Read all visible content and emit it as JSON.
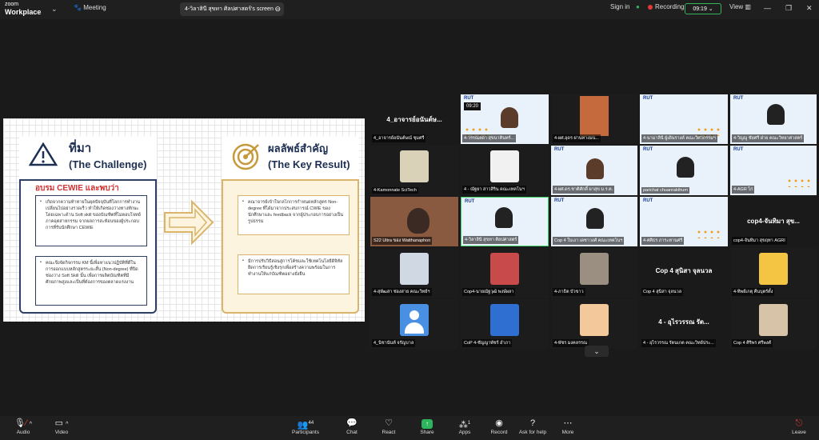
{
  "app": {
    "brand_line1": "zoom",
    "brand_line2": "Workplace"
  },
  "topbar": {
    "meeting_label": "Meeting",
    "screen_tab": "4-วิลาสินี สุขทา ศิลปศาสตร์'s screen",
    "signin": "Sign in",
    "recording": "Recording",
    "time": "09:19",
    "view": "View"
  },
  "slide": {
    "left_title_th": "ที่มา",
    "left_title_en": "(The Challenge)",
    "left_red_title": "อบรม CEWIE และพบว่า",
    "left_item1": "เกิดจากความท้าทายในยุคปัจจุบันที่โลกการทำงานเปลี่ยนไปอย่างรวดเร็ว ทำให้เกิดช่องว่างทางทักษะ โดยเฉพาะด้าน Soft skill ของบัณฑิตที่ไม่ตอบโจทย์ภาคอุตสาหกรรม จากผลการสะท้อนของผู้ประกอบการที่รับนักศึกษา CEWIE",
    "left_item2": "คณะจึงจัดกิจกรรม KM นี้เพื่อหาแนวปฏิบัติที่ดีในการออกแบบหลักสูตรระยะสั้น (Non-degree) ที่ปิดช่องว่าง Soft Skill นั้น เพื่อการผลิตบัณฑิตที่มีศักยภาพสูงและเป็นที่ต้องการของตลาดแรงงาน",
    "right_title_th": "ผลลัพธ์สำคัญ",
    "right_title_en": "(The Key Result)",
    "right_item1": "คณาจารย์เข้าใจกลไกการกำหนดหลักสูตร Non-degree ที่ได้มาจากประสบการณ์ CWIE ของนักศึกษาและ feedback จากผู้ประกอบการอย่างเป็นรูปธรรม",
    "right_item2": "มีการปรับวิธีสอนสู่การโค้ชและใช้เทคโนโลยีดิจิทัลยึดการเรียนรู้เชิงรุกเพื่อสร้างความพร้อมในการทำงานให้แก่บัณฑิตอย่างยั่งยืน"
  },
  "gallery": {
    "tiles": [
      {
        "big": "4_อาจารย์อนันต์ษ...",
        "name": "4_อาจารย์อนันต์ษณ์ ชุมศรี"
      },
      {
        "name": "4-วรรณลดา สุขนาคินทร์..."
      },
      {
        "name": "4-ผศ.อุดร ผ่านทางมน..."
      },
      {
        "name": "4-นามาลินี ผู้เดินรางค์ คณะวิศวกรรมฯ"
      },
      {
        "name": "4-วิญญู ชัยศรี ฝ่าย คณะวิทยาศาสตร์"
      },
      {
        "name": "4-Kamonnate SciTech"
      },
      {
        "name": "4 - ณัฐยา สาวสิริน คณะเทคโนฯ"
      },
      {
        "name": "4-ผศ.ดร.ชาติศักดิ์ ผาสุข ม.ร.ต."
      },
      {
        "name": "parichat chuanrakthum"
      },
      {
        "name": "4-AGR ไก่"
      },
      {
        "name": "S22 Ultra ของ Watthanaphon"
      },
      {
        "name": "4-วิลาสินี สุขทา ศิลปศาสตร์"
      },
      {
        "name": "Cop 4 ใบเงา เดชาวงศ์ คณะเทคโนฯ"
      },
      {
        "name": "4-ศศิธร ภาระทานศรี"
      },
      {
        "big": "cop4-จันทิมา สุข...",
        "name": "cop4-จันทิมา สุขฤทา AGRI"
      },
      {
        "name": "4-สุพัฒสา ช่องสาย คณะวิทย์ฯ"
      },
      {
        "name": "Cop4-นายณัฐวุฒิ พงษ์ผลา"
      },
      {
        "name": "4-ภาธิต บัวขาว"
      },
      {
        "big": "Cop 4 สุนิสา จุลนวล",
        "name": "Cop 4 สุนิสา จุลนวล"
      },
      {
        "name": "4-ทิพย์เกตุ คืนบุตร์ตั้ง"
      },
      {
        "name": "4_นิชานันท์ จรัญบาล"
      },
      {
        "name": "CoP 4-ชัญญาพัชร์ อำภา"
      },
      {
        "name": "4-พัชร มงคลรรณ"
      },
      {
        "big": "4 - อุไรวรรณ รัต...",
        "name": "4 - อุไรวรรณ รัตนเกต คณะวิทย์ประ..."
      },
      {
        "name": "Cop 4 ศิริพร ศรีพงศ์"
      }
    ],
    "overlay_time": "09:20"
  },
  "bottombar": {
    "audio": "Audio",
    "video": "Video",
    "participants": "Participants",
    "participants_count": "44",
    "chat": "Chat",
    "react": "React",
    "share": "Share",
    "apps": "Apps",
    "apps_count": "1",
    "record": "Record",
    "askforhelp": "Ask for help",
    "more": "More",
    "leave": "Leave"
  }
}
